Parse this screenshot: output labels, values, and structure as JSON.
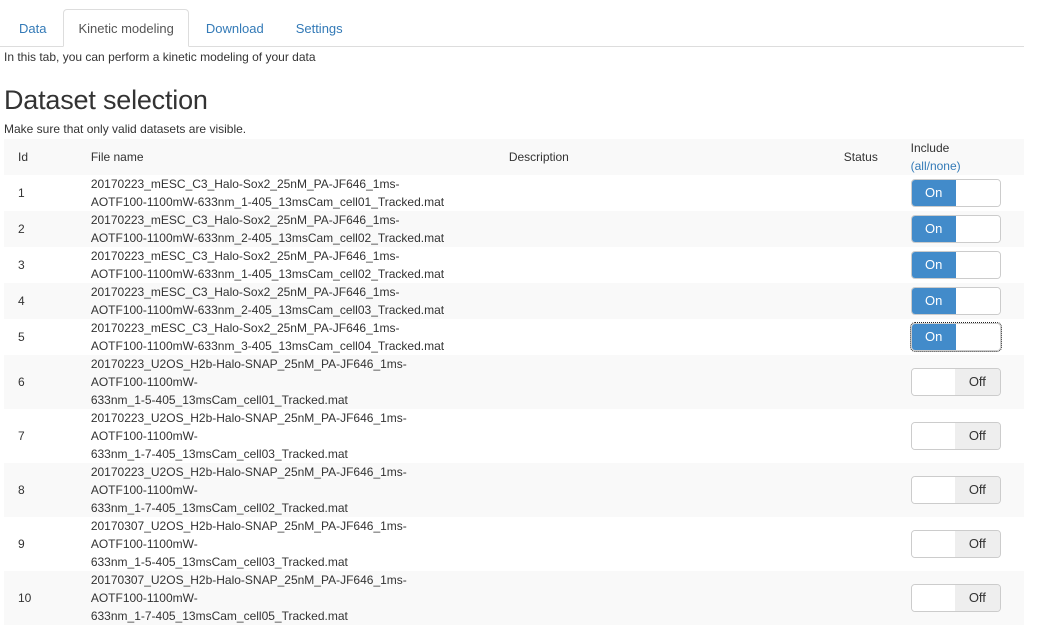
{
  "tabs": [
    {
      "label": "Data",
      "active": false
    },
    {
      "label": "Kinetic modeling",
      "active": true
    },
    {
      "label": "Download",
      "active": false
    },
    {
      "label": "Settings",
      "active": false
    }
  ],
  "intro_text": "In this tab, you can perform a kinetic modeling of your data",
  "section_title": "Dataset selection",
  "hint_text": "Make sure that only valid datasets are visible.",
  "table": {
    "headers": {
      "id": "Id",
      "file_name": "File name",
      "description": "Description",
      "status": "Status",
      "include": "Include",
      "include_link": "(all/none)"
    },
    "toggle_labels": {
      "on": "On",
      "off": "Off"
    },
    "rows": [
      {
        "id": "1",
        "file_lines": [
          "20170223_mESC_C3_Halo-Sox2_25nM_PA-JF646_1ms-",
          "AOTF100-1100mW-633nm_1-405_13msCam_cell01_Tracked.mat"
        ],
        "description": "",
        "status": "",
        "include": true
      },
      {
        "id": "2",
        "file_lines": [
          "20170223_mESC_C3_Halo-Sox2_25nM_PA-JF646_1ms-",
          "AOTF100-1100mW-633nm_2-405_13msCam_cell02_Tracked.mat"
        ],
        "description": "",
        "status": "",
        "include": true
      },
      {
        "id": "3",
        "file_lines": [
          "20170223_mESC_C3_Halo-Sox2_25nM_PA-JF646_1ms-",
          "AOTF100-1100mW-633nm_1-405_13msCam_cell02_Tracked.mat"
        ],
        "description": "",
        "status": "",
        "include": true
      },
      {
        "id": "4",
        "file_lines": [
          "20170223_mESC_C3_Halo-Sox2_25nM_PA-JF646_1ms-",
          "AOTF100-1100mW-633nm_2-405_13msCam_cell03_Tracked.mat"
        ],
        "description": "",
        "status": "",
        "include": true
      },
      {
        "id": "5",
        "file_lines": [
          "20170223_mESC_C3_Halo-Sox2_25nM_PA-JF646_1ms-",
          "AOTF100-1100mW-633nm_3-405_13msCam_cell04_Tracked.mat"
        ],
        "description": "",
        "status": "",
        "include": true,
        "focused": true
      },
      {
        "id": "6",
        "file_lines": [
          "20170223_U2OS_H2b-Halo-SNAP_25nM_PA-JF646_1ms-",
          "AOTF100-1100mW-",
          "633nm_1-5-405_13msCam_cell01_Tracked.mat"
        ],
        "description": "",
        "status": "",
        "include": false
      },
      {
        "id": "7",
        "file_lines": [
          "20170223_U2OS_H2b-Halo-SNAP_25nM_PA-JF646_1ms-",
          "AOTF100-1100mW-",
          "633nm_1-7-405_13msCam_cell03_Tracked.mat"
        ],
        "description": "",
        "status": "",
        "include": false
      },
      {
        "id": "8",
        "file_lines": [
          "20170223_U2OS_H2b-Halo-SNAP_25nM_PA-JF646_1ms-",
          "AOTF100-1100mW-",
          "633nm_1-7-405_13msCam_cell02_Tracked.mat"
        ],
        "description": "",
        "status": "",
        "include": false
      },
      {
        "id": "9",
        "file_lines": [
          "20170307_U2OS_H2b-Halo-SNAP_25nM_PA-JF646_1ms-",
          "AOTF100-1100mW-",
          "633nm_1-5-405_13msCam_cell03_Tracked.mat"
        ],
        "description": "",
        "status": "",
        "include": false
      },
      {
        "id": "10",
        "file_lines": [
          "20170307_U2OS_H2b-Halo-SNAP_25nM_PA-JF646_1ms-",
          "AOTF100-1100mW-",
          "633nm_1-7-405_13msCam_cell05_Tracked.mat"
        ],
        "description": "",
        "status": "",
        "include": false
      }
    ]
  },
  "colors": {
    "link": "#337ab7",
    "toggle_on": "#428bca",
    "toggle_off": "#eeeeee",
    "stripe": "#f9f9f9"
  }
}
